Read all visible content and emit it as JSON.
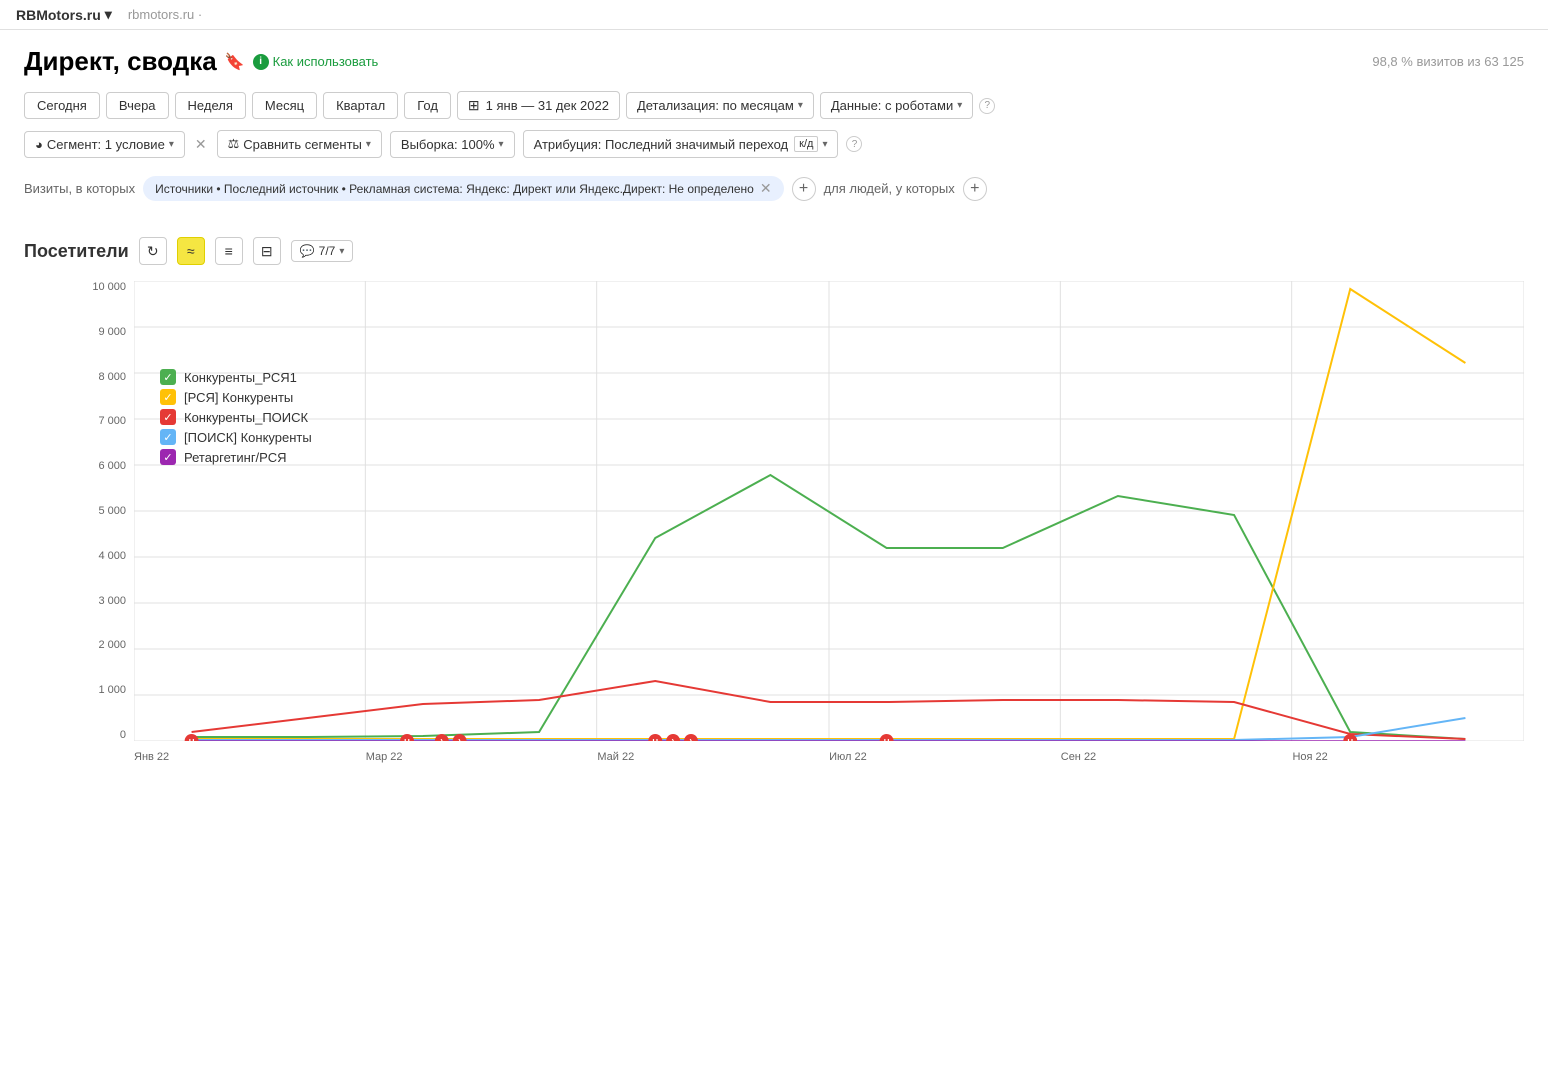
{
  "topbar": {
    "brand": "RBMotors.ru",
    "brand_arrow": "▾",
    "url": "rbmotors.ru ·"
  },
  "page": {
    "title": "Директ, сводка",
    "help_text": "Как использовать",
    "stat": "98,8 % визитов из 63 125"
  },
  "toolbar": {
    "period_buttons": [
      "Сегодня",
      "Вчера",
      "Неделя",
      "Месяц",
      "Квартал",
      "Год"
    ],
    "date_range": "1 янв — 31 дек 2022",
    "detail_label": "Детализация: по месяцам",
    "data_label": "Данные: с роботами"
  },
  "segment_bar": {
    "segment_label": "Сегмент: 1 условие",
    "compare_label": "Сравнить сегменты",
    "sample_label": "Выборка: 100%",
    "attribution_label": "Атрибуция: Последний значимый переход",
    "attribution_kd": "к/д"
  },
  "filter_bar": {
    "prefix": "Визиты, в которых",
    "filter_text": "Источники • Последний источник • Рекламная система: Яндекс: Директ или Яндекс.Директ: Не определено",
    "suffix": "для людей, у которых"
  },
  "chart": {
    "title": "Посетители",
    "legend": [
      {
        "label": "Конкуренты_РСЯ1",
        "color": "#4caf50",
        "checked": true
      },
      {
        "label": "[РСЯ] Конкуренты",
        "color": "#ffc107",
        "checked": true
      },
      {
        "label": "Конкуренты_ПОИСК",
        "color": "#e53935",
        "checked": true
      },
      {
        "label": "[ПОИСК] Конкуренты",
        "color": "#64b5f6",
        "checked": true
      },
      {
        "label": "Ретаргетинг/РСЯ",
        "color": "#9c27b0",
        "checked": true
      }
    ],
    "legend_count": "7/7",
    "y_labels": [
      "10 000",
      "9 000",
      "8 000",
      "7 000",
      "6 000",
      "5 000",
      "4 000",
      "3 000",
      "2 000",
      "1 000",
      "0"
    ],
    "x_labels": [
      "Янв 22",
      "Мар 22",
      "Май 22",
      "Июл 22",
      "Сен 22",
      "Ноя 22"
    ]
  }
}
